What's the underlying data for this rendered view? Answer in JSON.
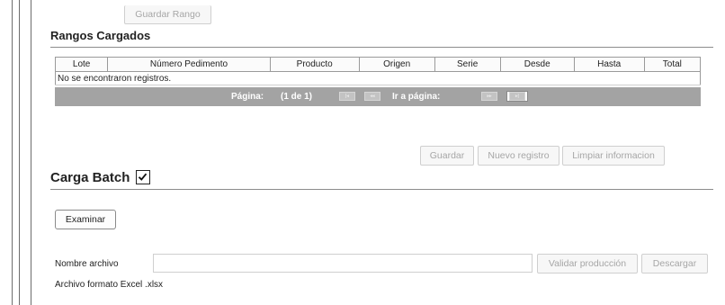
{
  "top_button": {
    "label": "Guardar Rango"
  },
  "rangos": {
    "title": "Rangos Cargados",
    "columns": [
      "Lote",
      "Número Pedimento",
      "Producto",
      "Origen",
      "Serie",
      "Desde",
      "Hasta",
      "Total"
    ],
    "empty_message": "No se encontraron registros.",
    "pager": {
      "page_label": "Página:",
      "page_info": "(1 de 1)",
      "goto_label": "Ir a página:",
      "first": "|◂",
      "prev": "◂◂",
      "next": "▸▸",
      "last": "▸|"
    }
  },
  "actions": {
    "guardar": "Guardar",
    "nuevo": "Nuevo registro",
    "limpiar": "Limpiar informacion"
  },
  "batch": {
    "title": "Carga Batch",
    "checked": true,
    "examinar": "Examinar",
    "file_label": "Nombre archivo",
    "file_value": "",
    "validar": "Validar producción",
    "descargar": "Descargar",
    "format_note": "Archivo formato Excel .xlsx"
  }
}
